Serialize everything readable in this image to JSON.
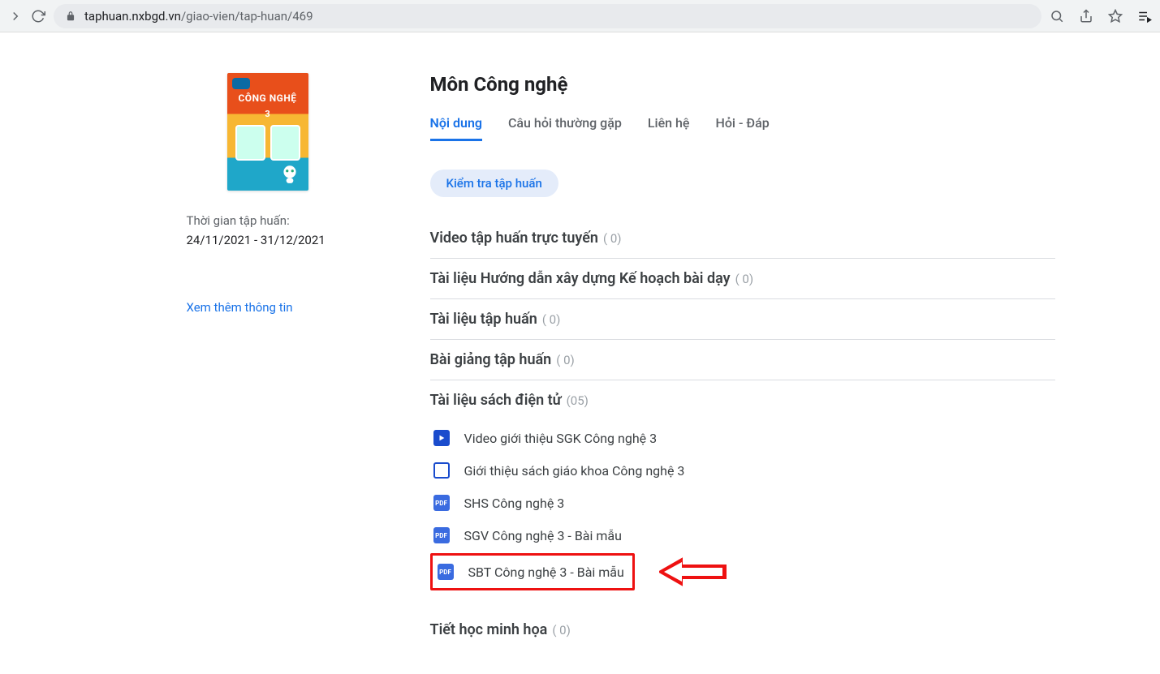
{
  "browser": {
    "url_domain": "taphuan.nxbgd.vn",
    "url_path": "/giao-vien/tap-huan/469"
  },
  "sidebar": {
    "book_title": "CÔNG NGHỆ",
    "book_grade": "3",
    "time_label": "Thời gian tập huấn:",
    "dates": "24/11/2021 - 31/12/2021",
    "more_link": "Xem thêm thông tin"
  },
  "page_title": "Môn Công nghệ",
  "tabs": [
    {
      "label": "Nội dung",
      "active": true
    },
    {
      "label": "Câu hỏi thường gặp",
      "active": false
    },
    {
      "label": "Liên hệ",
      "active": false
    },
    {
      "label": "Hỏi - Đáp",
      "active": false
    }
  ],
  "quiz_button": "Kiểm tra tập huấn",
  "sections": [
    {
      "title": "Video tập huấn trực tuyến",
      "count": "( 0)"
    },
    {
      "title": "Tài liệu Hướng dẫn xây dựng Kế hoạch bài dạy",
      "count": "( 0)"
    },
    {
      "title": "Tài liệu tập huấn",
      "count": "( 0)"
    },
    {
      "title": "Bài giảng tập huấn",
      "count": "( 0)"
    }
  ],
  "docs_section": {
    "title": "Tài liệu sách điện tử",
    "count": "(05)",
    "items": [
      {
        "icon": "play",
        "label": "Video giới thiệu SGK Công nghệ 3"
      },
      {
        "icon": "slide",
        "label": "Giới thiệu sách giáo khoa Công nghệ 3"
      },
      {
        "icon": "pdf",
        "label": "SHS Công nghệ 3"
      },
      {
        "icon": "pdf",
        "label": "SGV Công nghệ 3 - Bài mẫu"
      },
      {
        "icon": "pdf",
        "label": "SBT Công nghệ 3 - Bài mẫu",
        "highlight": true
      }
    ]
  },
  "last_section": {
    "title": "Tiết học minh họa",
    "count": "( 0)"
  }
}
